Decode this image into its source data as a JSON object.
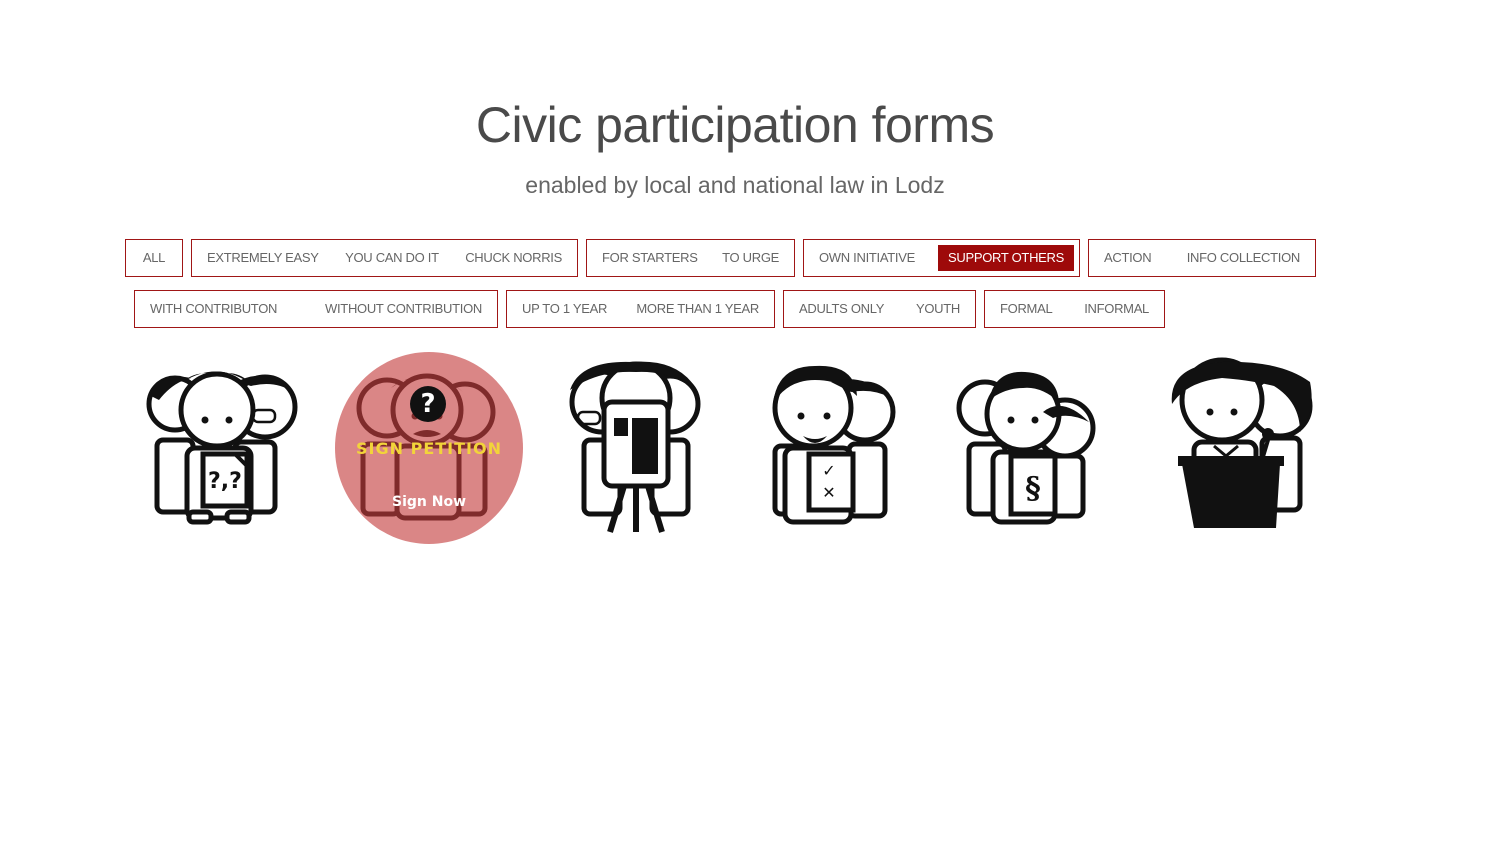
{
  "header": {
    "title": "Civic participation forms",
    "subtitle": "enabled by local and national law in Lodz"
  },
  "filters": {
    "row1": {
      "g1": [
        "ALL"
      ],
      "g2": [
        "EXTREMELY EASY",
        "YOU CAN DO IT",
        "CHUCK NORRIS"
      ],
      "g3": [
        "FOR STARTERS",
        "TO URGE"
      ],
      "g4": [
        "OWN INITIATIVE",
        "SUPPORT OTHERS"
      ],
      "g5": [
        "ACTION",
        "INFO COLLECTION"
      ]
    },
    "row2": {
      "g1": [
        "WITH CONTRIBUTON",
        "WITHOUT CONTRIBUTION"
      ],
      "g2": [
        "UP TO 1 YEAR",
        "MORE THAN 1 YEAR"
      ],
      "g3": [
        "ADULTS ONLY",
        "YOUTH"
      ],
      "g4": [
        "FORMAL",
        "INFORMAL"
      ]
    },
    "active": "SUPPORT OTHERS"
  },
  "figures": [
    {
      "icon": "question-paper-group-icon",
      "paper_glyphs": "? ? ?"
    },
    {
      "icon": "mustache-man-group-icon",
      "hover": {
        "badge": "?",
        "action": "SIGN PETITION",
        "cta": "Sign Now"
      }
    },
    {
      "icon": "survey-board-group-icon"
    },
    {
      "icon": "ballot-group-icon",
      "paper_glyphs": "✓ ✕"
    },
    {
      "icon": "law-paper-group-icon",
      "paper_glyphs": "§"
    },
    {
      "icon": "podium-speaker-icon"
    }
  ],
  "colors": {
    "accent": "#9e0a0a",
    "border": "#a01616",
    "overlay": "#c43c3c",
    "overlay_text": "#f2d43a"
  }
}
